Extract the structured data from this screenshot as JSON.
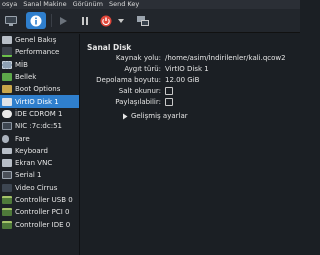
{
  "menubar": {
    "items": [
      "osya",
      "Sanal Makine",
      "Görünüm",
      "Send Key"
    ]
  },
  "sidebar": {
    "items": [
      {
        "label": "Genel Bakış",
        "icon": "monitor-icon",
        "selected": false
      },
      {
        "label": "Performance",
        "icon": "performance-graph-icon",
        "selected": false
      },
      {
        "label": "MİB",
        "icon": "cpu-icon",
        "selected": false
      },
      {
        "label": "Bellek",
        "icon": "memory-icon",
        "selected": false
      },
      {
        "label": "Boot Options",
        "icon": "boot-options-icon",
        "selected": false
      },
      {
        "label": "VirtIO Disk 1",
        "icon": "disk-icon",
        "selected": true
      },
      {
        "label": "İDE CDROM 1",
        "icon": "cdrom-icon",
        "selected": false
      },
      {
        "label": "NIC :7c:dc:51",
        "icon": "network-icon",
        "selected": false
      },
      {
        "label": "Fare",
        "icon": "mouse-icon",
        "selected": false
      },
      {
        "label": "Keyboard",
        "icon": "keyboard-icon",
        "selected": false
      },
      {
        "label": "Ekran VNC",
        "icon": "display-icon",
        "selected": false
      },
      {
        "label": "Serial 1",
        "icon": "serial-icon",
        "selected": false
      },
      {
        "label": "Video Cirrus",
        "icon": "video-icon",
        "selected": false
      },
      {
        "label": "Controller USB 0",
        "icon": "controller-icon",
        "selected": false
      },
      {
        "label": "Controller PCI 0",
        "icon": "controller-icon",
        "selected": false
      },
      {
        "label": "Controller IDE 0",
        "icon": "controller-icon",
        "selected": false
      }
    ]
  },
  "main": {
    "title": "Sanal Disk",
    "fields": {
      "kaynak_label": "Kaynak yolu:",
      "kaynak_value": "/home/asim/İndirilenler/kali.qcow2",
      "aygit_label": "Aygıt türü:",
      "aygit_value": "VirtIO Disk 1",
      "depolama_label": "Depolama boyutu:",
      "depolama_value": "12.00 GiB",
      "salt_label": "Salt okunur:",
      "paylas_label": "Paylaşılabilir:"
    },
    "advanced_label": "Gelişmiş ayarlar"
  },
  "toolbar": {
    "icons": [
      "monitor-icon",
      "info-icon",
      "play-icon",
      "pause-icon",
      "power-icon",
      "dropdown-icon",
      "snapshot-icon"
    ]
  },
  "colors": {
    "selected": "#2f7fcd",
    "panel_bg": "#1b1f24",
    "info_btn": "#2f7fcd",
    "power_red": "#e0463a"
  }
}
